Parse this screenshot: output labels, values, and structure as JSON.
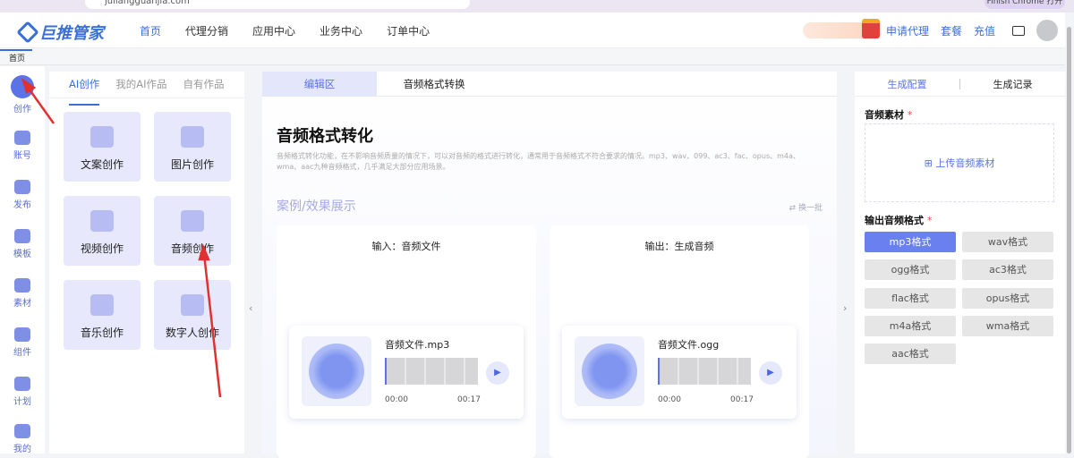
{
  "browser": {
    "url": "juliangguanjia.com",
    "profile": "Finish Chrome 打开"
  },
  "header": {
    "logo": "巨推管家",
    "nav": [
      "首页",
      "代理分销",
      "应用中心",
      "业务中心",
      "订单中心"
    ],
    "links": [
      "申请代理",
      "套餐",
      "充值"
    ]
  },
  "breadcrumb": "首页",
  "sidebar": [
    "创作",
    "账号",
    "发布",
    "模板",
    "素材",
    "组件",
    "计划",
    "我的"
  ],
  "left": {
    "tabs": [
      "AI创作",
      "我的AI作品",
      "自有作品"
    ],
    "cards": [
      "文案创作",
      "图片创作",
      "视频创作",
      "音频创作",
      "音乐创作",
      "数字人创作"
    ]
  },
  "center": {
    "tabs": [
      "编辑区",
      "音频格式转换"
    ],
    "title": "音频格式转化",
    "desc": "音频格式转化功能，在不影响音频质量的情况下，可以对音频的格式进行转化，通常用于音频格式不符合要求的情况。mp3、wav、099、ac3、fac、opus、m4a、wma、aac九种音频格式，几乎满足大部分应用场景。",
    "section": "案例/效果展示",
    "swap": "换一批",
    "input": {
      "label": "输入：音频文件",
      "file": "音频文件.mp3",
      "start": "00:00",
      "end": "00:17"
    },
    "output": {
      "label": "输出：生成音频",
      "file": "音频文件.ogg",
      "start": "00:00",
      "end": "00:17"
    }
  },
  "right": {
    "tabs": [
      "生成配置",
      "生成记录"
    ],
    "material_label": "音频素材",
    "upload": "上传音频素材",
    "format_label": "输出音频格式",
    "formats": [
      "mp3格式",
      "wav格式",
      "ogg格式",
      "ac3格式",
      "flac格式",
      "opus格式",
      "m4a格式",
      "wma格式",
      "aac格式"
    ],
    "selected": "mp3格式",
    "accent": "#5a73e6"
  }
}
